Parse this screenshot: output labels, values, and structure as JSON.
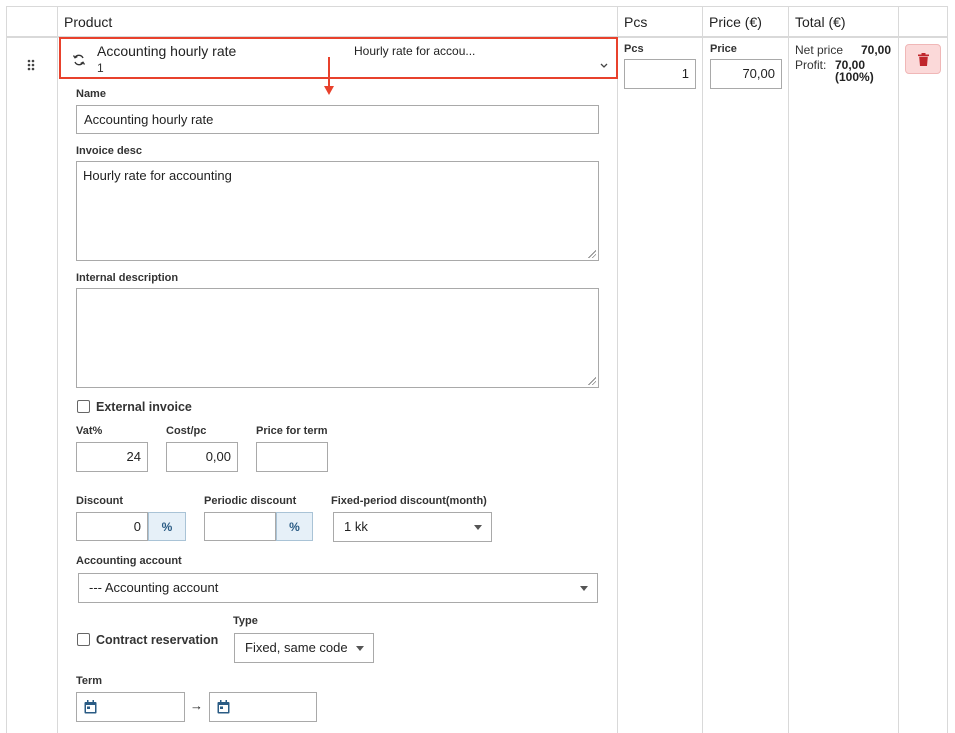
{
  "table": {
    "headers": {
      "product": "Product",
      "pcs": "Pcs",
      "price": "Price (€)",
      "total": "Total (€)"
    }
  },
  "product_selector": {
    "name": "Accounting hourly rate",
    "qty": "1",
    "description": "Hourly rate for accou..."
  },
  "row": {
    "pcs_label": "Pcs",
    "pcs_value": "1",
    "price_label": "Price",
    "price_value": "70,00",
    "net_price_label": "Net price",
    "net_price_value": "70,00",
    "profit_label": "Profit:",
    "profit_value": "70,00",
    "profit_percent": "(100%)"
  },
  "form": {
    "name_label": "Name",
    "name_value": "Accounting hourly rate",
    "invoice_desc_label": "Invoice desc",
    "invoice_desc_value": "Hourly rate for accounting",
    "internal_desc_label": "Internal description",
    "internal_desc_value": "",
    "external_invoice_label": "External invoice",
    "vat_label": "Vat%",
    "vat_value": "24",
    "cost_label": "Cost/pc",
    "cost_value": "0,00",
    "price_term_label": "Price for term",
    "price_term_value": "",
    "discount_label": "Discount",
    "discount_value": "0",
    "discount_unit": "%",
    "periodic_discount_label": "Periodic discount",
    "periodic_discount_value": "",
    "periodic_discount_unit": "%",
    "fixed_period_label": "Fixed-period discount(month)",
    "fixed_period_value": "1 kk",
    "accounting_label": "Accounting account",
    "accounting_value": "--- Accounting account",
    "contract_reservation_label": "Contract reservation",
    "type_label": "Type",
    "type_value": "Fixed, same code",
    "term_label": "Term",
    "term_arrow": "→"
  },
  "colors": {
    "highlight": "#e8412c",
    "delete_bg": "#fbd9d9",
    "delete_icon": "#c0262c"
  },
  "icons": [
    "drag-handle-icon",
    "refresh-icon",
    "chevron-down-icon",
    "trash-icon",
    "calendar-icon",
    "arrow-right-icon"
  ]
}
